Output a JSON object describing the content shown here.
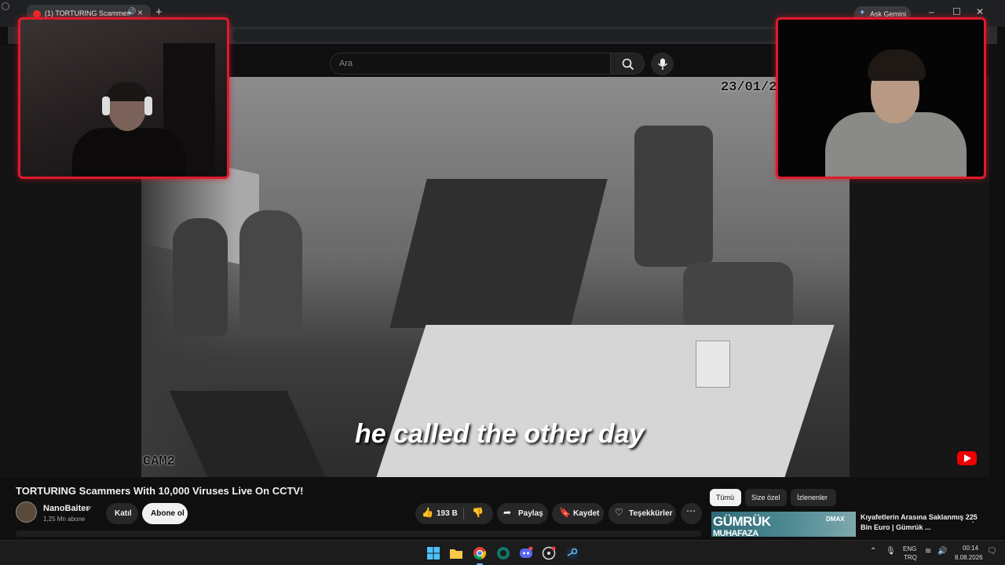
{
  "browser": {
    "tab_title": "(1) TORTURING Scammers",
    "gemini_label": "Ask Gemini"
  },
  "youtube_header": {
    "search_placeholder": "Ara"
  },
  "video": {
    "date_stamp": "23/01/20",
    "cam_label": "CAM2",
    "subtitle": "he called the other day"
  },
  "info": {
    "title": "TORTURING Scammers With 10,000 Viruses Live On CCTV!",
    "channel_name": "NanoBaiter",
    "subscribers": "1,25 Mn abone",
    "join_label": "Katıl",
    "subscribe_label": "Abone ol",
    "like_count": "193 B",
    "share_label": "Paylaş",
    "save_label": "Kaydet",
    "thanks_label": "Teşekkürler"
  },
  "chips": [
    "Tümü",
    "Size özel",
    "İzlenenler"
  ],
  "recommendation": {
    "thumb_text": "GÜMRÜK",
    "thumb_text_2": "MUHAFAZA",
    "badge": "DMAX",
    "title": "Kıyafetlerin Arasına Saklanmış 225 Bin Euro | Gümrük ..."
  },
  "taskbar": {
    "lang_top": "ENG",
    "lang_bottom": "TRQ",
    "time": "00:14",
    "date": "8.08.2026"
  },
  "colors": {
    "cam_border": "#e01a2b",
    "youtube_red": "#ee0000"
  }
}
